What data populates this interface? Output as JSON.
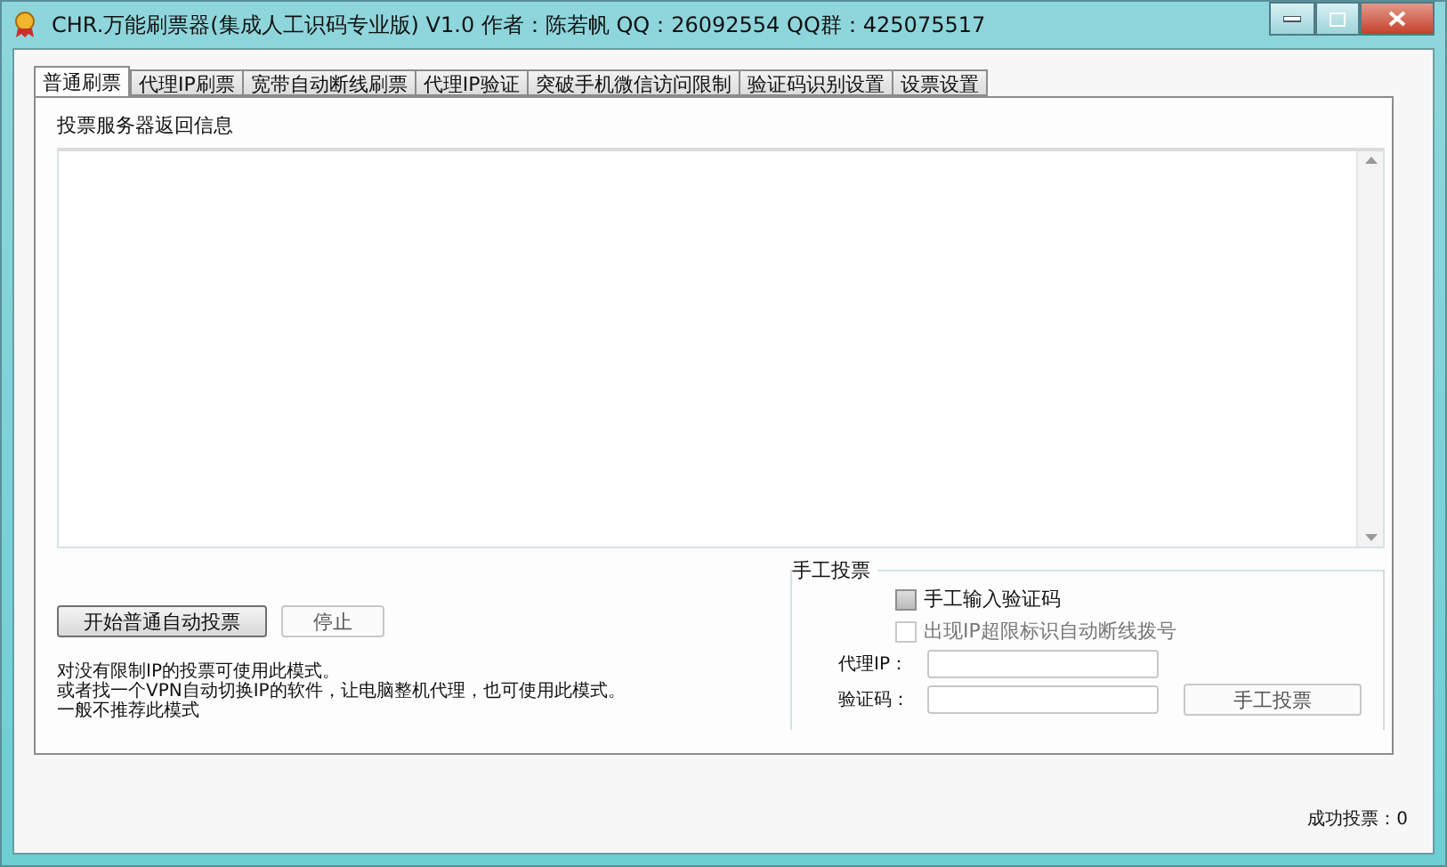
{
  "window": {
    "title": "CHR.万能刷票器(集成人工识码专业版) V1.0 作者：陈若帆 QQ：26092554 QQ群：425075517"
  },
  "tabs": [
    {
      "label": "普通刷票",
      "selected": true
    },
    {
      "label": "代理IP刷票",
      "selected": false
    },
    {
      "label": "宽带自动断线刷票",
      "selected": false
    },
    {
      "label": "代理IP验证",
      "selected": false
    },
    {
      "label": "突破手机微信访问限制",
      "selected": false
    },
    {
      "label": "验证码识别设置",
      "selected": false
    },
    {
      "label": "设票设置",
      "selected": false
    }
  ],
  "server_info": {
    "title": "投票服务器返回信息"
  },
  "buttons": [
    {
      "label": "开始普通自动投票",
      "kind": "primary"
    },
    {
      "label": "停止",
      "kind": "plain"
    }
  ],
  "notes": [
    "对没有限制IP的投票可使用此模式。",
    "或者找一个VPN自动切换IP的软件，让电脑整机代理，也可使用此模式。",
    "一般不推荐此模式"
  ],
  "manual": {
    "title": "手工投票",
    "options": [
      {
        "label": "手工输入验证码",
        "checked": false,
        "disabled": false
      },
      {
        "label": "出现IP超限标识自动断线拨号",
        "checked": false,
        "disabled": true
      }
    ],
    "fields": [
      {
        "label": "代理IP："
      },
      {
        "label": "验证码："
      }
    ],
    "button": "手工投票"
  },
  "status": "成功投票：0"
}
